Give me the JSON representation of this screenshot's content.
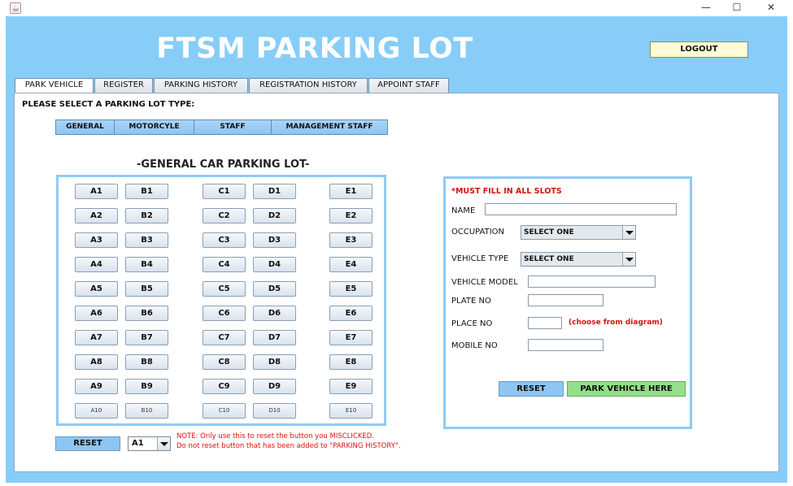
{
  "window": {
    "minimize": "—",
    "maximize": "☐",
    "close": "✕"
  },
  "header": {
    "title": "FTSM PARKING LOT",
    "logout_label": "LOGOUT"
  },
  "tabs": [
    "PARK VEHICLE",
    "REGISTER",
    "PARKING HISTORY",
    "REGISTRATION HISTORY",
    "APPOINT STAFF"
  ],
  "lot_type": {
    "prompt": "PLEASE SELECT A PARKING LOT TYPE:",
    "options": [
      "GENERAL",
      "MOTORCYLE",
      "STAFF",
      "MANAGEMENT STAFF"
    ]
  },
  "lot": {
    "title": "-GENERAL CAR PARKING LOT-",
    "columns": [
      [
        "A1",
        "A2",
        "A3",
        "A4",
        "A5",
        "A6",
        "A7",
        "A8",
        "A9",
        "A10"
      ],
      [
        "B1",
        "B2",
        "B3",
        "B4",
        "B5",
        "B6",
        "B7",
        "B8",
        "B9",
        "B10"
      ],
      [
        "C1",
        "C2",
        "C3",
        "C4",
        "C5",
        "C6",
        "C7",
        "C8",
        "C9",
        "C10"
      ],
      [
        "D1",
        "D2",
        "D3",
        "D4",
        "D5",
        "D6",
        "D7",
        "D8",
        "D9",
        "D10"
      ],
      [
        "E1",
        "E2",
        "E3",
        "E4",
        "E5",
        "E6",
        "E7",
        "E8",
        "E9",
        "E10"
      ]
    ]
  },
  "reset_area": {
    "reset_label": "RESET",
    "selected_slot": "A1",
    "note_line1": "NOTE: Only use this to reset the button you MISCLICKED.",
    "note_line2": "Do not reset button that has been added to \"PARKING HISTORY\"."
  },
  "form": {
    "must_fill": "*MUST FILL IN ALL SLOTS",
    "name_label": "NAME",
    "name_value": "",
    "occupation_label": "OCCUPATION",
    "occupation_value": "SELECT ONE",
    "vehicle_type_label": "VEHICLE TYPE",
    "vehicle_type_value": "SELECT ONE",
    "vehicle_model_label": "VEHICLE MODEL",
    "vehicle_model_value": "",
    "plate_label": "PLATE NO",
    "plate_value": "",
    "place_label": "PLACE NO",
    "place_value": "",
    "place_note": "(choose from diagram)",
    "mobile_label": "MOBILE NO",
    "mobile_value": "",
    "reset_label": "RESET",
    "park_label": "PARK VEHICLE HERE"
  }
}
